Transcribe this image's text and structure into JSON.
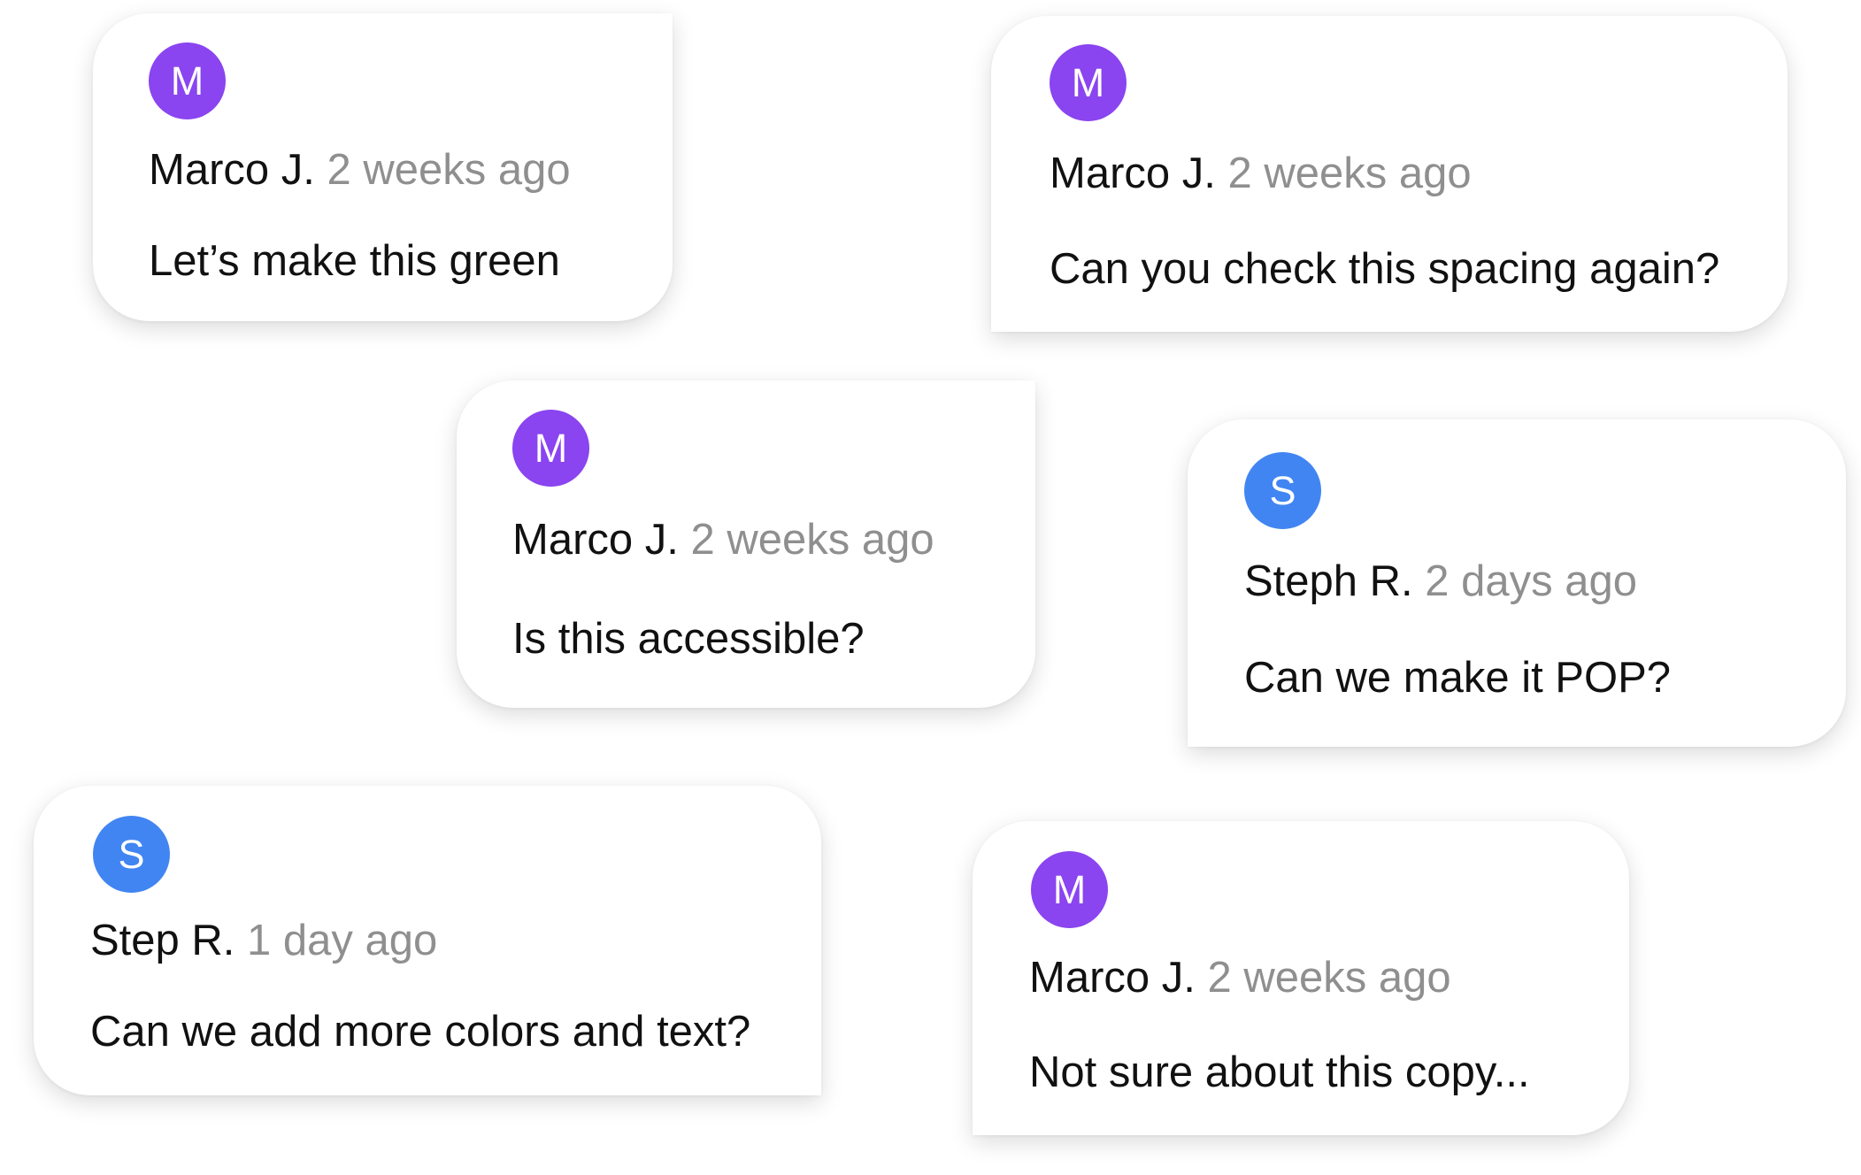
{
  "colors": {
    "avatar_m": "#8a44f0",
    "avatar_s": "#4185f2",
    "author_text": "#111111",
    "timestamp_text": "#8f8f8f",
    "card_background": "#ffffff"
  },
  "comments": [
    {
      "avatar_initial": "M",
      "author": "Marco J.",
      "time": "2 weeks ago",
      "message": "Let’s make this green"
    },
    {
      "avatar_initial": "M",
      "author": "Marco J.",
      "time": "2 weeks ago",
      "message": "Can you check this spacing again?"
    },
    {
      "avatar_initial": "M",
      "author": "Marco J.",
      "time": "2 weeks ago",
      "message": "Is this accessible?"
    },
    {
      "avatar_initial": "S",
      "author": "Steph R.",
      "time": "2 days ago",
      "message": "Can we make it POP?"
    },
    {
      "avatar_initial": "S",
      "author": "Step R.",
      "time": "1 day ago",
      "message": "Can we add more colors and text?"
    },
    {
      "avatar_initial": "M",
      "author": "Marco J.",
      "time": "2 weeks ago",
      "message": "Not sure about this copy..."
    }
  ]
}
